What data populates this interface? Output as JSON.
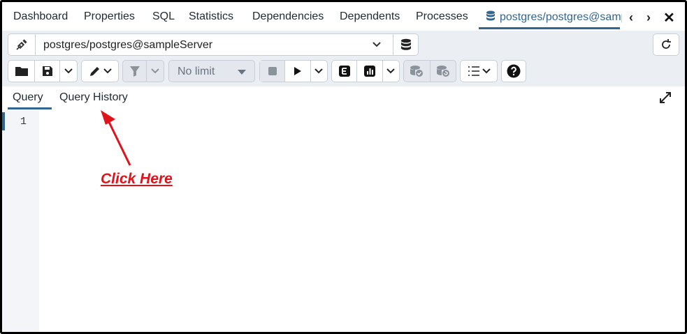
{
  "tabs": [
    {
      "label": "Dashboard"
    },
    {
      "label": "Properties"
    },
    {
      "label": "SQL"
    },
    {
      "label": "Statistics"
    },
    {
      "label": "Dependencies"
    },
    {
      "label": "Dependents"
    },
    {
      "label": "Processes"
    }
  ],
  "active_tab": {
    "label": "postgres/postgres@sampleServer",
    "icon": "database-icon"
  },
  "connection": {
    "value": "postgres/postgres@sampleServer"
  },
  "toolbar": {
    "limit_label": "No limit"
  },
  "subtabs": [
    {
      "label": "Query"
    },
    {
      "label": "Query History"
    }
  ],
  "editor": {
    "line_numbers": [
      "1"
    ]
  },
  "annotation": {
    "text": "Click Here",
    "color": "#e0121a"
  },
  "colors": {
    "accent": "#326690",
    "toolbar_bg": "#ebeef3"
  }
}
